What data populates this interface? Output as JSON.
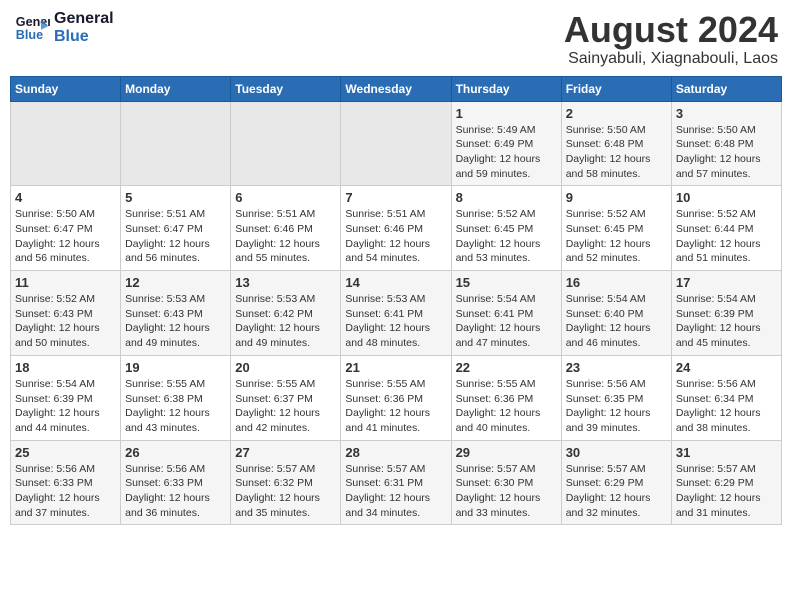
{
  "logo": {
    "line1": "General",
    "line2": "Blue"
  },
  "title": "August 2024",
  "location": "Sainyabuli, Xiagnabouli, Laos",
  "days_of_week": [
    "Sunday",
    "Monday",
    "Tuesday",
    "Wednesday",
    "Thursday",
    "Friday",
    "Saturday"
  ],
  "weeks": [
    [
      {
        "day": "",
        "info": ""
      },
      {
        "day": "",
        "info": ""
      },
      {
        "day": "",
        "info": ""
      },
      {
        "day": "",
        "info": ""
      },
      {
        "day": "1",
        "info": "Sunrise: 5:49 AM\nSunset: 6:49 PM\nDaylight: 12 hours\nand 59 minutes."
      },
      {
        "day": "2",
        "info": "Sunrise: 5:50 AM\nSunset: 6:48 PM\nDaylight: 12 hours\nand 58 minutes."
      },
      {
        "day": "3",
        "info": "Sunrise: 5:50 AM\nSunset: 6:48 PM\nDaylight: 12 hours\nand 57 minutes."
      }
    ],
    [
      {
        "day": "4",
        "info": "Sunrise: 5:50 AM\nSunset: 6:47 PM\nDaylight: 12 hours\nand 56 minutes."
      },
      {
        "day": "5",
        "info": "Sunrise: 5:51 AM\nSunset: 6:47 PM\nDaylight: 12 hours\nand 56 minutes."
      },
      {
        "day": "6",
        "info": "Sunrise: 5:51 AM\nSunset: 6:46 PM\nDaylight: 12 hours\nand 55 minutes."
      },
      {
        "day": "7",
        "info": "Sunrise: 5:51 AM\nSunset: 6:46 PM\nDaylight: 12 hours\nand 54 minutes."
      },
      {
        "day": "8",
        "info": "Sunrise: 5:52 AM\nSunset: 6:45 PM\nDaylight: 12 hours\nand 53 minutes."
      },
      {
        "day": "9",
        "info": "Sunrise: 5:52 AM\nSunset: 6:45 PM\nDaylight: 12 hours\nand 52 minutes."
      },
      {
        "day": "10",
        "info": "Sunrise: 5:52 AM\nSunset: 6:44 PM\nDaylight: 12 hours\nand 51 minutes."
      }
    ],
    [
      {
        "day": "11",
        "info": "Sunrise: 5:52 AM\nSunset: 6:43 PM\nDaylight: 12 hours\nand 50 minutes."
      },
      {
        "day": "12",
        "info": "Sunrise: 5:53 AM\nSunset: 6:43 PM\nDaylight: 12 hours\nand 49 minutes."
      },
      {
        "day": "13",
        "info": "Sunrise: 5:53 AM\nSunset: 6:42 PM\nDaylight: 12 hours\nand 49 minutes."
      },
      {
        "day": "14",
        "info": "Sunrise: 5:53 AM\nSunset: 6:41 PM\nDaylight: 12 hours\nand 48 minutes."
      },
      {
        "day": "15",
        "info": "Sunrise: 5:54 AM\nSunset: 6:41 PM\nDaylight: 12 hours\nand 47 minutes."
      },
      {
        "day": "16",
        "info": "Sunrise: 5:54 AM\nSunset: 6:40 PM\nDaylight: 12 hours\nand 46 minutes."
      },
      {
        "day": "17",
        "info": "Sunrise: 5:54 AM\nSunset: 6:39 PM\nDaylight: 12 hours\nand 45 minutes."
      }
    ],
    [
      {
        "day": "18",
        "info": "Sunrise: 5:54 AM\nSunset: 6:39 PM\nDaylight: 12 hours\nand 44 minutes."
      },
      {
        "day": "19",
        "info": "Sunrise: 5:55 AM\nSunset: 6:38 PM\nDaylight: 12 hours\nand 43 minutes."
      },
      {
        "day": "20",
        "info": "Sunrise: 5:55 AM\nSunset: 6:37 PM\nDaylight: 12 hours\nand 42 minutes."
      },
      {
        "day": "21",
        "info": "Sunrise: 5:55 AM\nSunset: 6:36 PM\nDaylight: 12 hours\nand 41 minutes."
      },
      {
        "day": "22",
        "info": "Sunrise: 5:55 AM\nSunset: 6:36 PM\nDaylight: 12 hours\nand 40 minutes."
      },
      {
        "day": "23",
        "info": "Sunrise: 5:56 AM\nSunset: 6:35 PM\nDaylight: 12 hours\nand 39 minutes."
      },
      {
        "day": "24",
        "info": "Sunrise: 5:56 AM\nSunset: 6:34 PM\nDaylight: 12 hours\nand 38 minutes."
      }
    ],
    [
      {
        "day": "25",
        "info": "Sunrise: 5:56 AM\nSunset: 6:33 PM\nDaylight: 12 hours\nand 37 minutes."
      },
      {
        "day": "26",
        "info": "Sunrise: 5:56 AM\nSunset: 6:33 PM\nDaylight: 12 hours\nand 36 minutes."
      },
      {
        "day": "27",
        "info": "Sunrise: 5:57 AM\nSunset: 6:32 PM\nDaylight: 12 hours\nand 35 minutes."
      },
      {
        "day": "28",
        "info": "Sunrise: 5:57 AM\nSunset: 6:31 PM\nDaylight: 12 hours\nand 34 minutes."
      },
      {
        "day": "29",
        "info": "Sunrise: 5:57 AM\nSunset: 6:30 PM\nDaylight: 12 hours\nand 33 minutes."
      },
      {
        "day": "30",
        "info": "Sunrise: 5:57 AM\nSunset: 6:29 PM\nDaylight: 12 hours\nand 32 minutes."
      },
      {
        "day": "31",
        "info": "Sunrise: 5:57 AM\nSunset: 6:29 PM\nDaylight: 12 hours\nand 31 minutes."
      }
    ]
  ]
}
